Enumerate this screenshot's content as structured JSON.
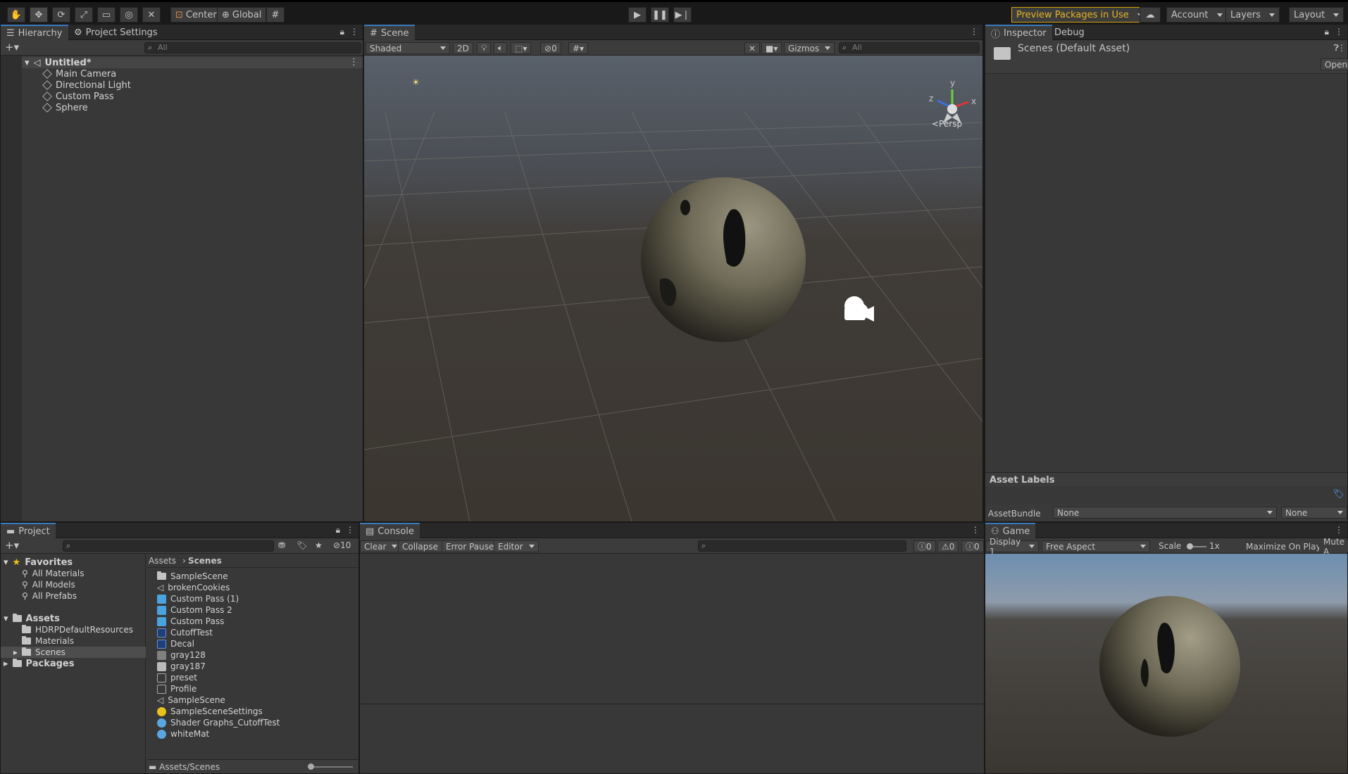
{
  "toolbar": {
    "center": "Center",
    "global": "Global",
    "preview": "Preview Packages in Use",
    "account": "Account",
    "layers": "Layers",
    "layout": "Layout"
  },
  "hierarchy": {
    "tab": "Hierarchy",
    "settings_tab": "Project Settings",
    "search_placeholder": "All",
    "scene": "Untitled*",
    "items": [
      "Main Camera",
      "Directional Light",
      "Custom Pass",
      "Sphere"
    ]
  },
  "scene": {
    "tab": "Scene",
    "shading": "Shaded",
    "mode2d": "2D",
    "hidden_count": "0",
    "gizmos": "Gizmos",
    "search_placeholder": "All",
    "persp": "Persp",
    "axis_y": "y",
    "axis_x": "x",
    "axis_z": "z"
  },
  "inspector": {
    "tab": "Inspector",
    "debug_tab": "Debug",
    "asset_title": "Scenes (Default Asset)",
    "open_btn": "Open",
    "asset_labels": "Asset Labels",
    "assetbundle_label": "AssetBundle",
    "assetbundle_value": "None",
    "variant_value": "None"
  },
  "project": {
    "tab": "Project",
    "hidden_count": "10",
    "favorites": "Favorites",
    "fav_items": [
      "All Materials",
      "All Models",
      "All Prefabs"
    ],
    "assets": "Assets",
    "asset_folders": [
      "HDRPDefaultResources",
      "Materials",
      "Scenes"
    ],
    "packages": "Packages",
    "breadcrumb": [
      "Assets",
      "Scenes"
    ],
    "files": [
      "SampleScene",
      "brokenCookies",
      "Custom Pass (1)",
      "Custom Pass 2",
      "Custom Pass",
      "CutoffTest",
      "Decal",
      "gray128",
      "gray187",
      "preset",
      "Profile",
      "SampleScene",
      "SampleSceneSettings",
      "Shader Graphs_CutoffTest",
      "whiteMat"
    ],
    "path": "Assets/Scenes"
  },
  "console": {
    "tab": "Console",
    "clear": "Clear",
    "collapse": "Collapse",
    "error_pause": "Error Pause",
    "editor": "Editor",
    "log_count": "0",
    "warn_count": "0",
    "error_count": "0"
  },
  "game": {
    "tab": "Game",
    "display": "Display 1",
    "aspect": "Free Aspect",
    "scale_label": "Scale",
    "scale_value": "1x",
    "maximize": "Maximize On Play",
    "mute": "Mute A"
  },
  "colors": {
    "accent": "#3a79bb",
    "preview_border": "#d4a20a",
    "panel_bg": "#383838"
  }
}
